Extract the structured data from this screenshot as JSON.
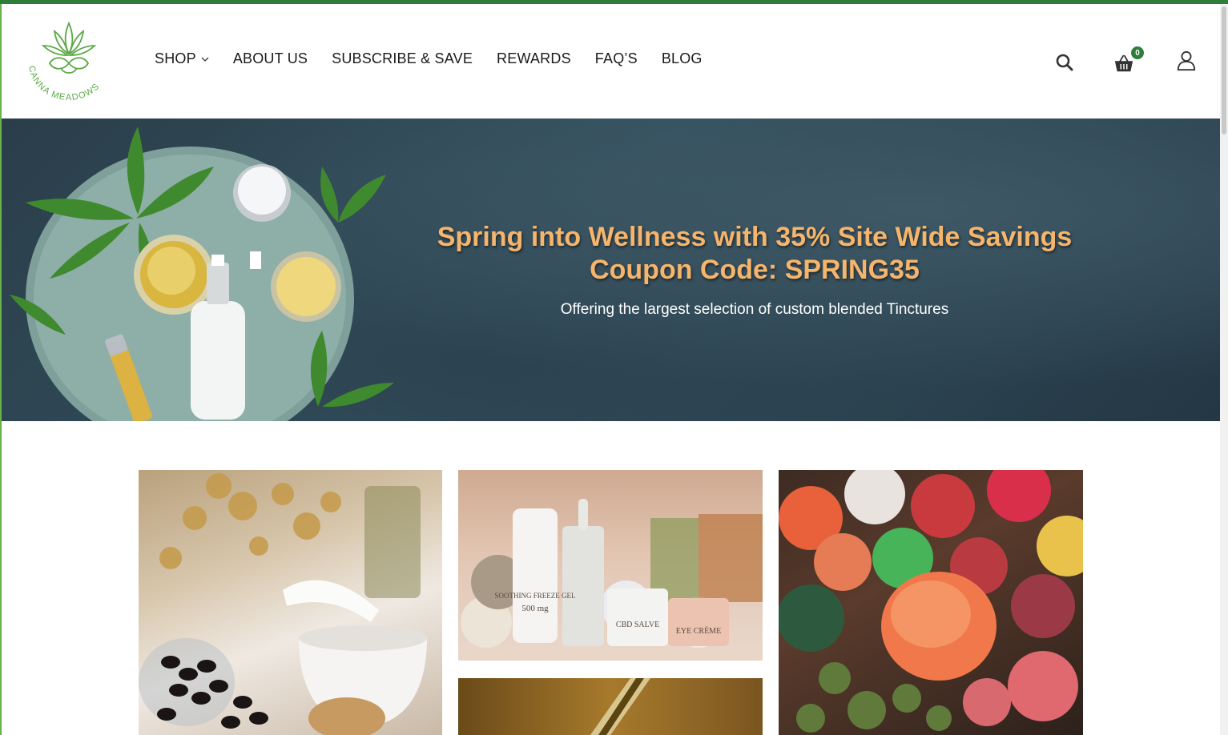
{
  "brand": {
    "name": "CANNA MEADOWS",
    "color": "#2f7d3b",
    "accent": "#67b24a"
  },
  "nav": {
    "items": [
      {
        "label": "SHOP",
        "has_dropdown": true
      },
      {
        "label": "ABOUT US"
      },
      {
        "label": "SUBSCRIBE & SAVE"
      },
      {
        "label": "REWARDS"
      },
      {
        "label": "FAQ’S"
      },
      {
        "label": "BLOG"
      }
    ]
  },
  "header_icons": {
    "search": "search-icon",
    "cart": "basket-icon",
    "account": "user-icon",
    "cart_count": "0"
  },
  "hero": {
    "title_line1": "Spring into Wellness with 35% Site Wide Savings",
    "title_line2": "Coupon Code: SPRING35",
    "subtitle": "Offering the largest selection of custom blended Tinctures",
    "title_color": "#f6b56c"
  },
  "tiles": {
    "capsules": {
      "image": "capsules-mortar-photo"
    },
    "topicals": {
      "image": "topical-products-photo",
      "product_labels": [
        "SOOTHING FREEZE GEL",
        "500 mg",
        "CBD SALVE",
        "EYE CRÈME"
      ]
    },
    "tinctures": {
      "image": "tincture-dropper-photo"
    },
    "gummies": {
      "image": "gummies-photo"
    }
  }
}
